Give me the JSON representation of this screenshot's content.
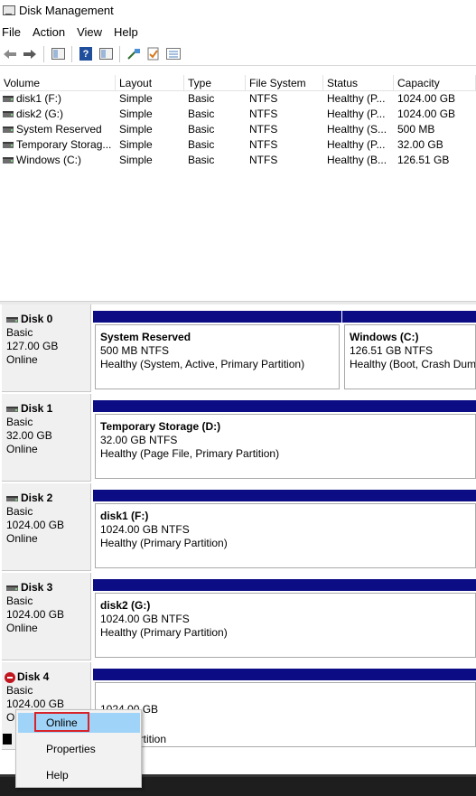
{
  "window": {
    "title": "Disk Management",
    "icon": "disk-management-icon"
  },
  "menu": [
    "File",
    "Action",
    "View",
    "Help"
  ],
  "toolbar": {
    "buttons": [
      "back-arrow-icon",
      "forward-arrow-icon",
      "show-hide-console-tree-icon",
      "help-icon",
      "properties-icon",
      "connect-icon",
      "check-icon",
      "list-icon"
    ]
  },
  "volume_list": {
    "columns": [
      "Volume",
      "Layout",
      "Type",
      "File System",
      "Status",
      "Capacity"
    ],
    "rows": [
      {
        "volume": "disk1 (F:)",
        "layout": "Simple",
        "type": "Basic",
        "fs": "NTFS",
        "status": "Healthy (P...",
        "capacity": "1024.00 GB"
      },
      {
        "volume": "disk2 (G:)",
        "layout": "Simple",
        "type": "Basic",
        "fs": "NTFS",
        "status": "Healthy (P...",
        "capacity": "1024.00 GB"
      },
      {
        "volume": "System Reserved",
        "layout": "Simple",
        "type": "Basic",
        "fs": "NTFS",
        "status": "Healthy (S...",
        "capacity": "500 MB"
      },
      {
        "volume": "Temporary Storag...",
        "layout": "Simple",
        "type": "Basic",
        "fs": "NTFS",
        "status": "Healthy (P...",
        "capacity": "32.00 GB"
      },
      {
        "volume": "Windows (C:)",
        "layout": "Simple",
        "type": "Basic",
        "fs": "NTFS",
        "status": "Healthy (B...",
        "capacity": "126.51 GB"
      }
    ]
  },
  "disks": [
    {
      "name": "Disk 0",
      "type": "Basic",
      "size": "127.00 GB",
      "state": "Online",
      "partitions": [
        {
          "name": "System Reserved",
          "size_fs": "500 MB NTFS",
          "status": "Healthy (System, Active, Primary Partition)"
        },
        {
          "name": "Windows  (C:)",
          "size_fs": "126.51 GB NTFS",
          "status": "Healthy (Boot, Crash Dump"
        }
      ]
    },
    {
      "name": "Disk 1",
      "type": "Basic",
      "size": "32.00 GB",
      "state": "Online",
      "partitions": [
        {
          "name": "Temporary Storage  (D:)",
          "size_fs": "32.00 GB NTFS",
          "status": "Healthy (Page File, Primary Partition)"
        }
      ]
    },
    {
      "name": "Disk 2",
      "type": "Basic",
      "size": "1024.00 GB",
      "state": "Online",
      "partitions": [
        {
          "name": "disk1  (F:)",
          "size_fs": "1024.00 GB NTFS",
          "status": "Healthy (Primary Partition)"
        }
      ]
    },
    {
      "name": "Disk 3",
      "type": "Basic",
      "size": "1024.00 GB",
      "state": "Online",
      "partitions": [
        {
          "name": "disk2  (G:)",
          "size_fs": "1024.00 GB NTFS",
          "status": "Healthy (Primary Partition)"
        }
      ]
    },
    {
      "name": "Disk 4",
      "type": "Basic",
      "size": "1024.00 GB",
      "state": "O",
      "partitions": [
        {
          "name": "",
          "size_fs": "1024.00 GB",
          "status": ""
        }
      ]
    }
  ],
  "legend": {
    "visible_text": "artition"
  },
  "context_menu": {
    "items": [
      "Online",
      "Properties",
      "Help"
    ],
    "highlighted": "Online"
  },
  "colors": {
    "partition_bar": "#0c0c84",
    "highlight": "#9fd3f7",
    "focus_outline": "#d8232a"
  }
}
